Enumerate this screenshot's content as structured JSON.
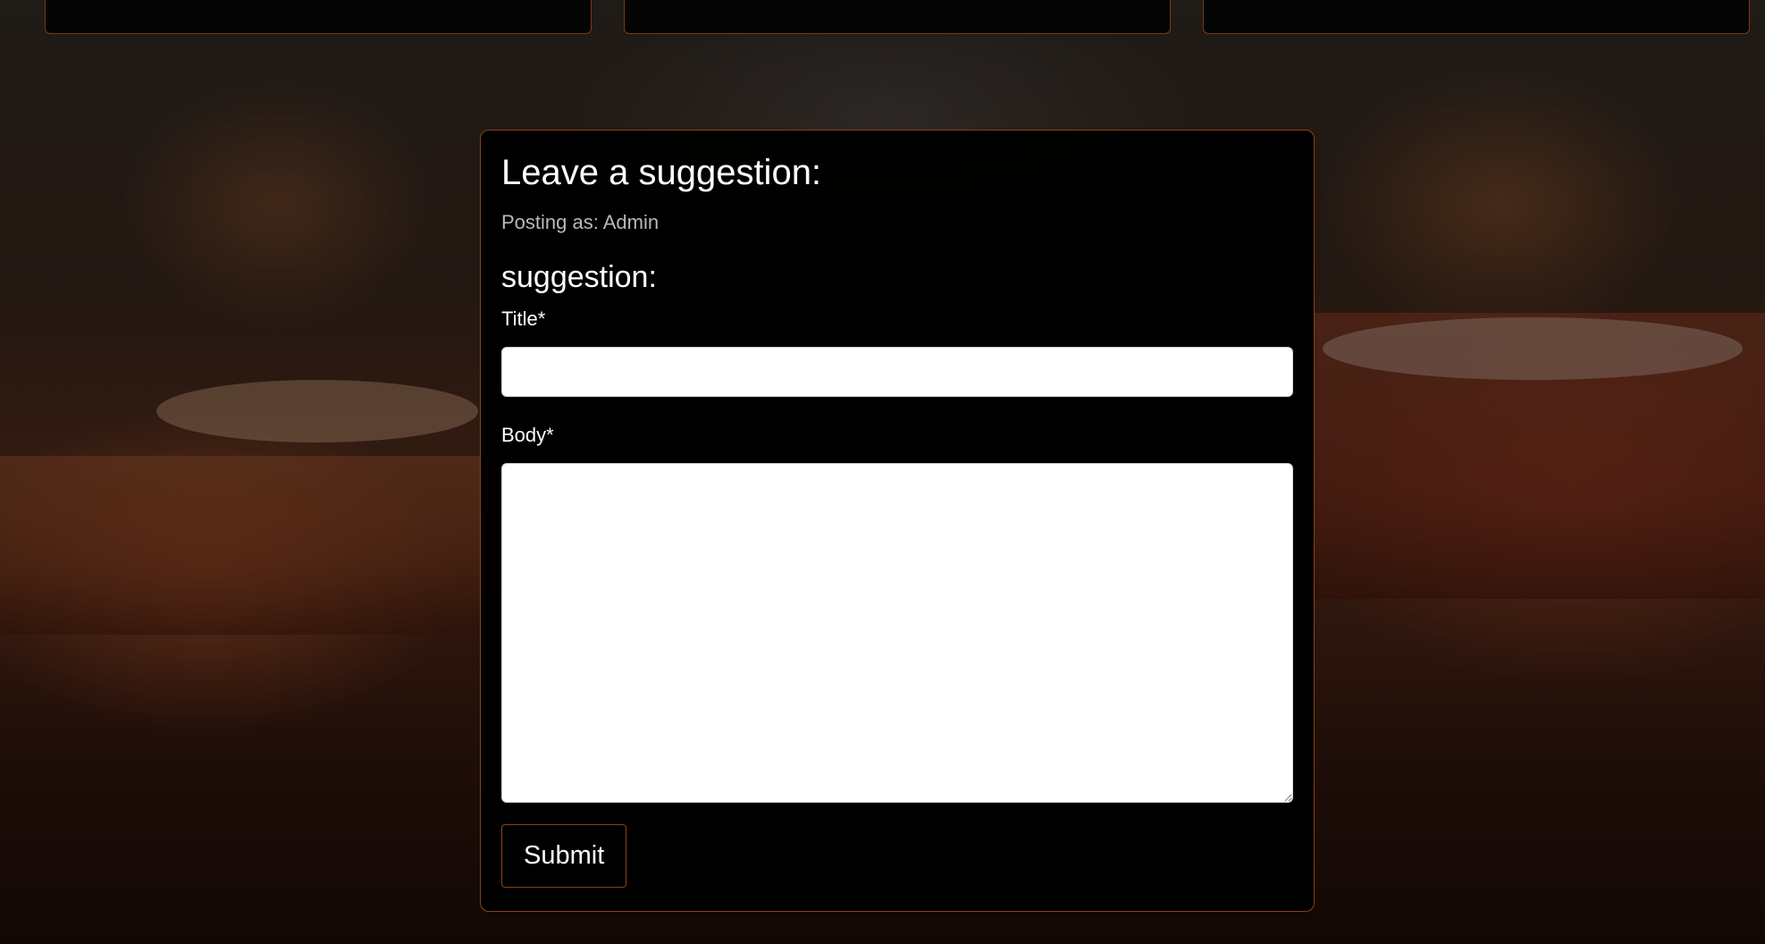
{
  "form": {
    "title": "Leave a suggestion:",
    "posting_as": "Posting as: Admin",
    "section_title": "suggestion:",
    "fields": {
      "title_label": "Title*",
      "title_value": "",
      "body_label": "Body*",
      "body_value": ""
    },
    "submit_label": "Submit"
  },
  "colors": {
    "card_background": "#000000",
    "card_border": "#8a4216",
    "text": "#ffffff",
    "muted_text": "#b8b8b8"
  }
}
